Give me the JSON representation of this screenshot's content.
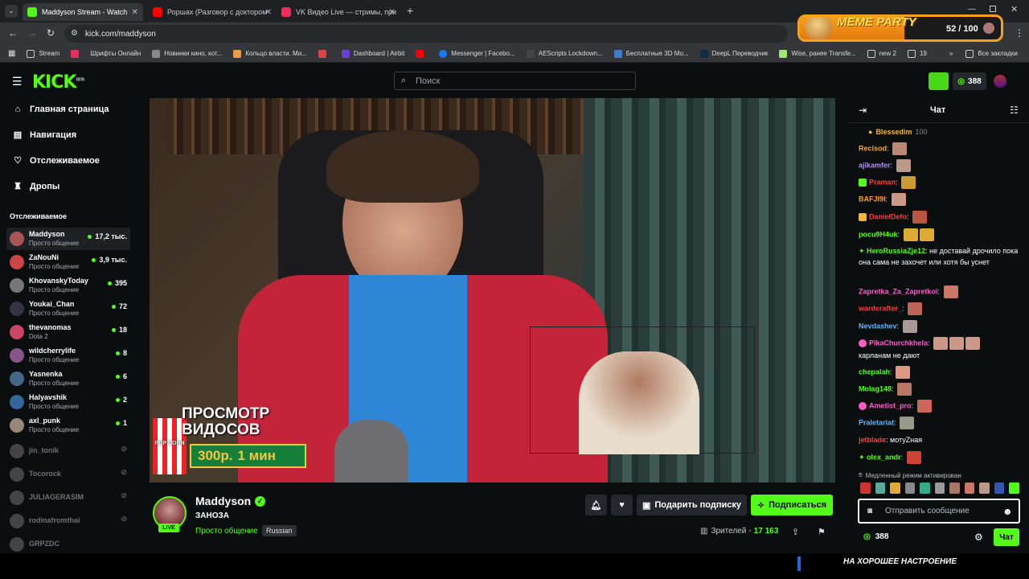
{
  "browser": {
    "tabs": [
      {
        "label": "Maddyson Stream - Watch",
        "color": "#53fc18",
        "active": true
      },
      {
        "label": "Роршах (Разговор с доктором",
        "color": "#ff0000",
        "active": false
      },
      {
        "label": "VK Видео Live — стримы, при",
        "color": "#e6305a",
        "active": false
      }
    ],
    "url": "kick.com/maddyson",
    "bookmarks": [
      "Stream",
      "Шрифты Онлайн",
      "Новинки кино, кот...",
      "Кольцо власти. Ми...",
      "Dashboard | Airbit",
      "Messenger | Facebo...",
      "AEScripts Lockdown...",
      "Бесплатные 3D Мо...",
      "DeepL Переводчик",
      "Wise, ранее Transfe...",
      "new 2",
      "19",
      "Все закладки"
    ]
  },
  "meme_widget": {
    "title": "MEME PARTY",
    "count": "52 / 100",
    "progress": 0.52
  },
  "kick": {
    "logo": "KICK",
    "search_placeholder": "Поиск",
    "header_points": "388",
    "nav": [
      "Главная страница",
      "Навигация",
      "Отслеживаемое",
      "Дропы"
    ],
    "following_title": "Отслеживаемое",
    "following": [
      {
        "name": "Maddyson",
        "category": "Просто общение",
        "viewers": "17,2 тыс.",
        "live": true
      },
      {
        "name": "ZaNouNi",
        "category": "Просто общение",
        "viewers": "3,9 тыс.",
        "live": true
      },
      {
        "name": "KhovanskyToday",
        "category": "Просто общение",
        "viewers": "395",
        "live": true
      },
      {
        "name": "Youkai_Chan",
        "category": "Просто общение",
        "viewers": "72",
        "live": true
      },
      {
        "name": "thevanomas",
        "category": "Dota 2",
        "viewers": "18",
        "live": true
      },
      {
        "name": "wildcherrylife",
        "category": "Просто общение",
        "viewers": "8",
        "live": true
      },
      {
        "name": "Yasnenka",
        "category": "Просто общение",
        "viewers": "6",
        "live": true
      },
      {
        "name": "Halyavshik",
        "category": "Просто общение",
        "viewers": "2",
        "live": true
      },
      {
        "name": "axl_punk",
        "category": "Просто общение",
        "viewers": "1",
        "live": true
      },
      {
        "name": "jin_tonik",
        "live": false
      },
      {
        "name": "Tocorock",
        "live": false
      },
      {
        "name": "JULIAGERASIM",
        "live": false
      },
      {
        "name": "rodinafromthai",
        "live": false
      },
      {
        "name": "GRPZDC",
        "live": false
      }
    ]
  },
  "video": {
    "promo_line1": "ПРОСМОТР",
    "promo_line2": "ВИДОСОВ",
    "promo_price": "300р.",
    "promo_time": "1 мин",
    "popcorn": "POP CORN"
  },
  "stream": {
    "streamer": "Maddyson",
    "title": "ЗАНОЗА",
    "category": "Просто общение",
    "tag": "Russian",
    "live_label": "LIVE",
    "gift_label": "Подарить подписку",
    "subscribe_label": "Подписаться",
    "viewers_label": "Зрителей",
    "viewers": "17 163"
  },
  "chat": {
    "title": "Чат",
    "pinned": {
      "user": "Blessedim",
      "amount": "100"
    },
    "messages": [
      {
        "user": "Recisod",
        "color": "#f3a53b",
        "text": ""
      },
      {
        "user": "ajikamfer",
        "color": "#b58cff",
        "text": ""
      },
      {
        "user": "Praman",
        "color": "#ff3b3b",
        "text": ""
      },
      {
        "user": "BAFJI9I",
        "color": "#ff9c3b",
        "text": ""
      },
      {
        "user": "DanielDefo",
        "color": "#ff3b3b",
        "text": ""
      },
      {
        "user": "pocu9H4uk",
        "color": "#53fc18",
        "text": ""
      },
      {
        "user": "HeroRussiaZje12",
        "color": "#53fc18",
        "text": "не доставай дрочило пока она сама не захочет или хотя бы уснет"
      },
      {
        "user": "Zapretka_Za_Zapretkoi",
        "color": "#ff5bc8",
        "text": ""
      },
      {
        "user": "wardcrafter_",
        "color": "#ff3b3b",
        "text": ""
      },
      {
        "user": "Nevdashev",
        "color": "#5ab6ff",
        "text": ""
      },
      {
        "user": "PikaChurchkhela",
        "color": "#ff5bc8",
        "text": "карланам не дают"
      },
      {
        "user": "chepalah",
        "color": "#53fc18",
        "text": ""
      },
      {
        "user": "Molag148",
        "color": "#53fc18",
        "text": ""
      },
      {
        "user": "Ametist_pro",
        "color": "#ff5bc8",
        "text": ""
      },
      {
        "user": "Praletariat",
        "color": "#5ab6ff",
        "text": ""
      },
      {
        "user": "jetblade",
        "color": "#ff3b3b",
        "text": "мотуZная"
      },
      {
        "user": "olex_andr",
        "color": "#53fc18",
        "text": ""
      }
    ],
    "slow_mode": "Медленный режим активирован",
    "input_placeholder": "Отправить сообщение",
    "points": "388",
    "send_label": "Чат"
  },
  "bottom_ticker": "НА ХОРОШЕЕ НАСТРОЕНИЕ",
  "colors": {
    "kick_green": "#53fc18",
    "bg": "#0b0e0f"
  }
}
